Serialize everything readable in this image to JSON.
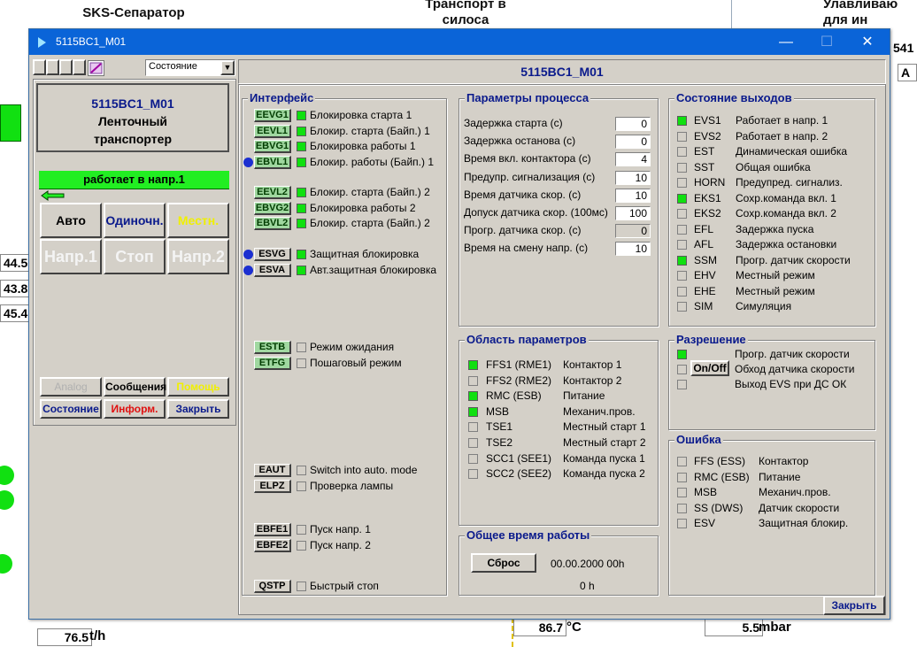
{
  "background": {
    "titles": [
      "SKS-Сепаратор",
      "Транспорт в\nсилоса",
      "Улавливаю\nдля ин"
    ],
    "values": [
      "44.5",
      "43.8",
      "45.4",
      "541",
      "A",
      "76.5",
      "t/h",
      "86.7",
      "°C",
      "5.5",
      "mbar"
    ]
  },
  "window": {
    "title": "5115BC1_M01",
    "minimize": "—",
    "maximize": "☐",
    "close": "✕",
    "header_title": "5115BC1_M01",
    "dropdown_value": "Состояние"
  },
  "device": {
    "name": "5115BC1_M01",
    "type_line1": "Ленточный",
    "type_line2": "транспортер",
    "status": "работает в напр.1",
    "status_color": "#22ee22",
    "buttons": {
      "auto": "Авто",
      "single": "Одиночн.",
      "local": "Местн.",
      "dir1": "Напр.1",
      "stop": "Стоп",
      "dir2": "Напр.2",
      "analog": "Analog",
      "messages": "Сообщения",
      "help": "Помощь",
      "state": "Состояние",
      "info": "Информ.",
      "close": "Закрыть"
    }
  },
  "interface": {
    "title": "Интерфейс",
    "items": [
      {
        "tag": "EEVG1",
        "label": "Блокировка старта 1",
        "on": true,
        "dot": false,
        "green": true
      },
      {
        "tag": "EEVL1",
        "label": "Блокир. старта (Байп.) 1",
        "on": true,
        "dot": false,
        "green": true
      },
      {
        "tag": "EBVG1",
        "label": "Блокировка работы 1",
        "on": true,
        "dot": false,
        "green": true
      },
      {
        "tag": "EBVL1",
        "label": "Блокир. работы (Байп.) 1",
        "on": true,
        "dot": true,
        "green": true
      },
      {
        "tag": "EEVL2",
        "label": "Блокир. старта (Байп.) 2",
        "on": true,
        "dot": false,
        "green": true
      },
      {
        "tag": "EBVG2",
        "label": "Блокировка работы 2",
        "on": true,
        "dot": false,
        "green": true
      },
      {
        "tag": "EBVL2",
        "label": "Блокир. старта (Байп.) 2",
        "on": true,
        "dot": false,
        "green": true
      },
      {
        "tag": "ESVG",
        "label": "Защитная блокировка",
        "on": true,
        "dot": true,
        "green": false
      },
      {
        "tag": "ESVA",
        "label": "Авт.защитная блокировка",
        "on": true,
        "dot": true,
        "green": false
      },
      {
        "tag": "ESTB",
        "label": "Режим ожидания",
        "on": false,
        "dot": false,
        "green": true
      },
      {
        "tag": "ETFG",
        "label": "Пошаговый режим",
        "on": false,
        "dot": false,
        "green": true
      },
      {
        "tag": "EAUT",
        "label": "Switch into auto. mode",
        "on": false,
        "dot": false,
        "green": false
      },
      {
        "tag": "ELPZ",
        "label": "Проверка лампы",
        "on": false,
        "dot": false,
        "green": false
      },
      {
        "tag": "EBFE1",
        "label": "Пуск напр. 1",
        "on": false,
        "dot": false,
        "green": false
      },
      {
        "tag": "EBFE2",
        "label": "Пуск напр. 2",
        "on": false,
        "dot": false,
        "green": false
      },
      {
        "tag": "QSTP",
        "label": "Быстрый стоп",
        "on": false,
        "dot": false,
        "green": false
      }
    ]
  },
  "process": {
    "title": "Параметры процесса",
    "items": [
      {
        "label": "Задержка старта (с)",
        "value": "0",
        "grey": false
      },
      {
        "label": "Задержка останова (с)",
        "value": "0",
        "grey": false
      },
      {
        "label": "Время вкл. контактора (с)",
        "value": "4",
        "grey": false
      },
      {
        "label": "Предупр. сигнализация (с)",
        "value": "10",
        "grey": false
      },
      {
        "label": "Время датчика скор. (с)",
        "value": "10",
        "grey": false
      },
      {
        "label": "Допуск датчика скор. (100мс)",
        "value": "100",
        "grey": false
      },
      {
        "label": "Прогр. датчика скор. (с)",
        "value": "0",
        "grey": true
      },
      {
        "label": "Время на смену напр. (с)",
        "value": "10",
        "grey": false
      }
    ]
  },
  "params_area": {
    "title": "Область параметров",
    "items": [
      {
        "code": "FFS1 (RME1)",
        "label": "Контактор 1",
        "on": true
      },
      {
        "code": "FFS2 (RME2)",
        "label": "Контактор 2",
        "on": false
      },
      {
        "code": "RMC (ESB)",
        "label": "Питание",
        "on": true
      },
      {
        "code": "MSB",
        "label": "Механич.пров.",
        "on": true
      },
      {
        "code": "TSE1",
        "label": "Местный старт 1",
        "on": false
      },
      {
        "code": "TSE2",
        "label": "Местный старт 2",
        "on": false
      },
      {
        "code": "SCC1 (SEE1)",
        "label": "Команда пуска 1",
        "on": false
      },
      {
        "code": "SCC2 (SEE2)",
        "label": "Команда пуска 2",
        "on": false
      }
    ]
  },
  "runtime": {
    "title": "Общее время работы",
    "reset": "Сброс",
    "date": "00.00.2000 00h",
    "hours": "0 h"
  },
  "outputs": {
    "title": "Состояние выходов",
    "items": [
      {
        "code": "EVS1",
        "label": "Работает в напр. 1",
        "on": true
      },
      {
        "code": "EVS2",
        "label": "Работает в напр. 2",
        "on": false
      },
      {
        "code": "EST",
        "label": "Динамическая ошибка",
        "on": false
      },
      {
        "code": "SST",
        "label": "Общая ошибка",
        "on": false
      },
      {
        "code": "HORN",
        "label": "Предупред. сигнализ.",
        "on": false
      },
      {
        "code": "EKS1",
        "label": "Сохр.команда вкл. 1",
        "on": true
      },
      {
        "code": "EKS2",
        "label": "Сохр.команда вкл. 2",
        "on": false
      },
      {
        "code": "EFL",
        "label": "Задержка пуска",
        "on": false
      },
      {
        "code": "AFL",
        "label": "Задержка остановки",
        "on": false
      },
      {
        "code": "SSM",
        "label": "Прогр. датчик скорости",
        "on": true
      },
      {
        "code": "EHV",
        "label": "Местный режим",
        "on": false
      },
      {
        "code": "EHE",
        "label": "Местный режим",
        "on": false
      },
      {
        "code": "SIM",
        "label": "Симуляция",
        "on": false
      }
    ]
  },
  "permission": {
    "title": "Разрешение",
    "onoff": "On/Off",
    "items": [
      {
        "label": "Прогр. датчик скорости",
        "on": true
      },
      {
        "label": "Обход датчика скорости",
        "on": false
      },
      {
        "label": "Выход EVS при ДС ОК",
        "on": false
      }
    ]
  },
  "errors": {
    "title": "Ошибка",
    "items": [
      {
        "code": "FFS (ESS)",
        "label": "Контактор",
        "on": false
      },
      {
        "code": "RMC (ESB)",
        "label": "Питание",
        "on": false
      },
      {
        "code": "MSB",
        "label": "Механич.пров.",
        "on": false
      },
      {
        "code": "SS (DWS)",
        "label": "Датчик скорости",
        "on": false
      },
      {
        "code": "ESV",
        "label": "Защитная блокир.",
        "on": false
      }
    ]
  },
  "footer": {
    "close": "Закрыть"
  }
}
